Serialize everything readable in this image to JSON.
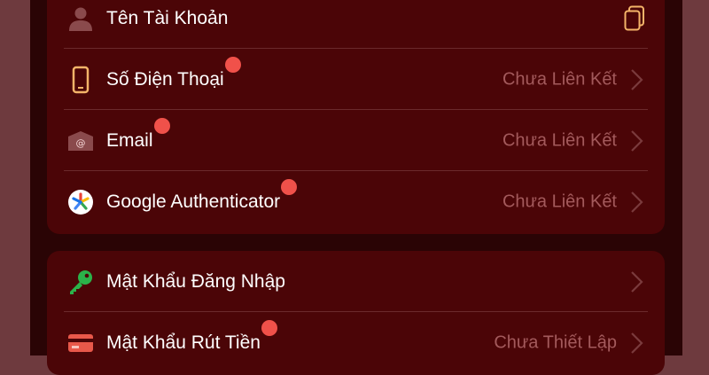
{
  "account_section": {
    "items": [
      {
        "label": "Tên Tài Khoản",
        "icon": "user-icon",
        "status": "",
        "action_icon": "copy-icon"
      },
      {
        "label": "Số Điện Thoại",
        "icon": "phone-icon",
        "status": "Chưa Liên Kết",
        "action_icon": "chevron-right-icon"
      },
      {
        "label": "Email",
        "icon": "email-icon",
        "status": "Chưa Liên Kết",
        "action_icon": "chevron-right-icon"
      },
      {
        "label": "Google Authenticator",
        "icon": "google-authenticator-icon",
        "status": "Chưa Liên Kết",
        "action_icon": "chevron-right-icon"
      }
    ]
  },
  "security_section": {
    "items": [
      {
        "label": "Mật Khẩu Đăng Nhập",
        "icon": "key-icon",
        "status": "",
        "action_icon": "chevron-right-icon"
      },
      {
        "label": "Mật Khẩu Rút Tiền",
        "icon": "card-icon",
        "status": "Chưa Thiết Lập",
        "action_icon": "chevron-right-icon"
      }
    ]
  },
  "colors": {
    "background": "#6e3a3e",
    "panel": "#2a0405",
    "card": "#4b0507",
    "status_text": "#a35a5c",
    "notification_dot": "#f0514a",
    "icon_accent": "#f4b469"
  }
}
